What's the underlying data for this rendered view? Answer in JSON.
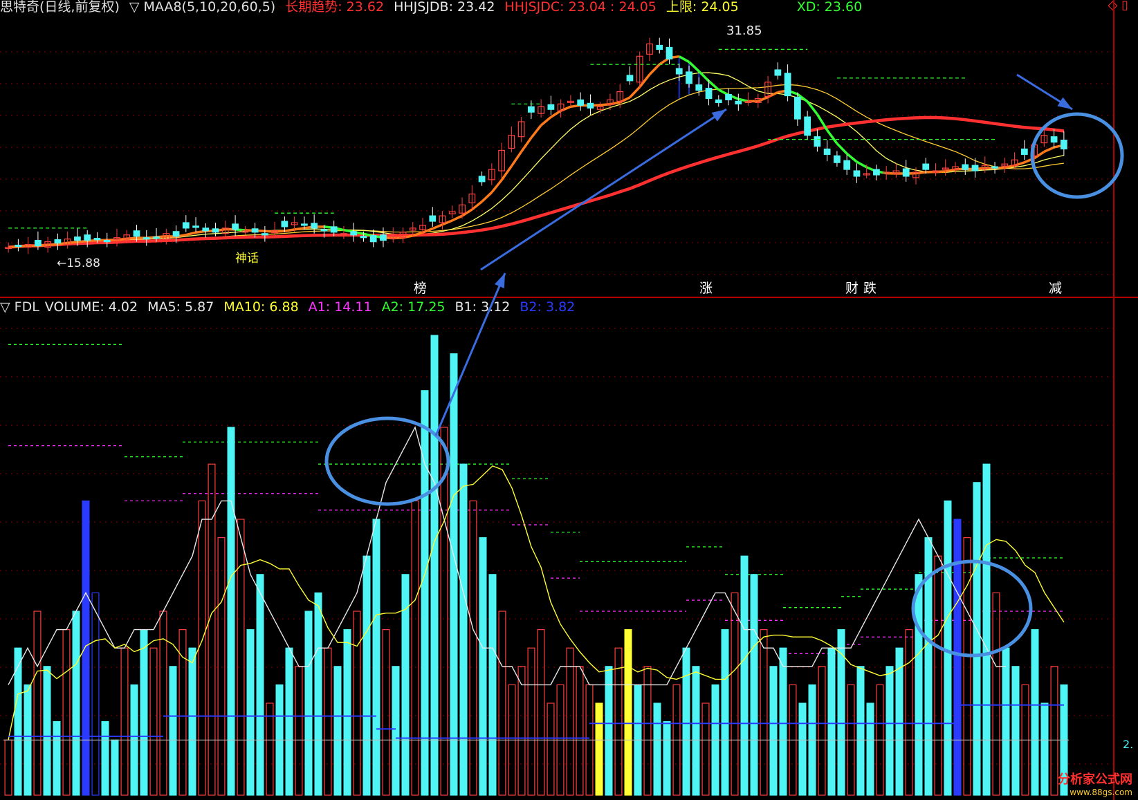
{
  "top_header": {
    "stock_label": "思特奇(日线,前复权)",
    "ma_label": "▽ MAA8(5,10,20,60,5)",
    "trend": "长期趋势: 23.62",
    "hhjsjdb": "HHJSJDB: 23.42",
    "hhjsjdc": "HHJSJDC: 23.04 : 24.05",
    "upper": "上限: 24.05",
    "xd": "XD: 23.60"
  },
  "bottom_header": {
    "indicator": "▽ FDL",
    "volume": "VOLUME: 4.02",
    "ma5": "MA5: 5.87",
    "ma10": "MA10: 6.88",
    "a1": "A1: 14.11",
    "a2": "A2: 17.25",
    "b1": "B1: 3.12",
    "b2": "B2: 3.82"
  },
  "colors": {
    "trend": "#ff3030",
    "white": "#e8e8e8",
    "yellow": "#ffff33",
    "magenta": "#ff33ff",
    "green": "#33ff33",
    "blue": "#2a3bff",
    "cyan": "#4ff5f5",
    "up": "#ff4040",
    "grid": "#8b0000"
  },
  "annotations": {
    "low_price": "←15.88",
    "high_price": "31.85",
    "shen_hua": "神话",
    "bang": "榜",
    "zhang": "涨",
    "cai": "财",
    "die": "跌",
    "jian": "减",
    "bottom_right_value": "2.",
    "watermark": "分析家公式网",
    "watermark_url": "www.88gs.com",
    "top_right_icons": "◇ ▯"
  },
  "chart_data": [
    {
      "type": "candlestick",
      "title": "思特奇(日线,前复权)",
      "price_range": [
        14.5,
        33
      ],
      "high": 31.85,
      "low": 15.88,
      "close_path": [
        16.4,
        16.5,
        16.6,
        16.5,
        16.8,
        16.7,
        17.0,
        16.9,
        16.9,
        17.0,
        16.8,
        17.1,
        17.3,
        17.2,
        17.0,
        17.1,
        17.4,
        17.2,
        17.8,
        17.9,
        17.6,
        17.5,
        17.8,
        17.7,
        17.6,
        17.5,
        17.3,
        17.6,
        17.9,
        18.2,
        18.0,
        17.8,
        17.6,
        17.5,
        17.4,
        17.3,
        17.1,
        16.8,
        16.9,
        17.2,
        17.5,
        17.8,
        18.0,
        18.3,
        18.7,
        19.0,
        19.5,
        20.3,
        21.2,
        22.1,
        23.5,
        24.6,
        25.6,
        26.3,
        26.7,
        26.5,
        26.9,
        27.1,
        26.8,
        26.6,
        26.7,
        27.2,
        27.8,
        28.6,
        30.4,
        31.3,
        30.9,
        30.2,
        29.1,
        28.4,
        27.9,
        27.3,
        27.0,
        27.2,
        26.9,
        27.1,
        27.3,
        28.5,
        29.0,
        27.5,
        25.8,
        24.6,
        23.8,
        23.2,
        22.6,
        22.1,
        21.6,
        21.8,
        21.7,
        21.9,
        22.0,
        21.6,
        21.9,
        22.1,
        22.0,
        22.2,
        22.3,
        22.1,
        22.0,
        22.4,
        22.2,
        22.5,
        22.8,
        23.2,
        23.9,
        24.6,
        24.1,
        23.6
      ]
    },
    {
      "type": "bar",
      "title": "FDL VOLUME",
      "ylim": [
        0,
        25
      ],
      "values": [
        3,
        8,
        6,
        10,
        7,
        4,
        9,
        10,
        16,
        11,
        4,
        3,
        8,
        6,
        9,
        8,
        10,
        7,
        9,
        8,
        16,
        18,
        14,
        20,
        15,
        9,
        12,
        5,
        6,
        8,
        7,
        10,
        11,
        8,
        7,
        9,
        10,
        13,
        15,
        9,
        7,
        12,
        16,
        22,
        25,
        20,
        24,
        18,
        16,
        14,
        12,
        10,
        6,
        7,
        8,
        9,
        5,
        6,
        8,
        7,
        6,
        5,
        7,
        8,
        9,
        6,
        7,
        5,
        4,
        6,
        8,
        7,
        5,
        6,
        9,
        11,
        13,
        12,
        9,
        7,
        8,
        6,
        5,
        6,
        7,
        8,
        9,
        6,
        7,
        5,
        6,
        7,
        8,
        9,
        12,
        14,
        13,
        16,
        15,
        14,
        17,
        18,
        11,
        8,
        7,
        6,
        9,
        5,
        7,
        6
      ],
      "ma_white": [
        6,
        7,
        8,
        7,
        8,
        9,
        9,
        10,
        11,
        10,
        9,
        8,
        8,
        9,
        9,
        9,
        10,
        11,
        12,
        13,
        15,
        15,
        16,
        16,
        14,
        12,
        11,
        10,
        9,
        8,
        7,
        7,
        8,
        8,
        9,
        10,
        11,
        13,
        15,
        17,
        18,
        19,
        20,
        18,
        17,
        15,
        13,
        11,
        9,
        8,
        8,
        7,
        7,
        6,
        6,
        6,
        6,
        7,
        7,
        7,
        6,
        6,
        6,
        6,
        6,
        6,
        6,
        6,
        6,
        7,
        8,
        9,
        10,
        11,
        11,
        10,
        9,
        9,
        8,
        8,
        7,
        7,
        7,
        7,
        8,
        8,
        8,
        8,
        9,
        10,
        11,
        12,
        13,
        14,
        15,
        14,
        13,
        12,
        11,
        10,
        9,
        8,
        7,
        7
      ]
    }
  ]
}
